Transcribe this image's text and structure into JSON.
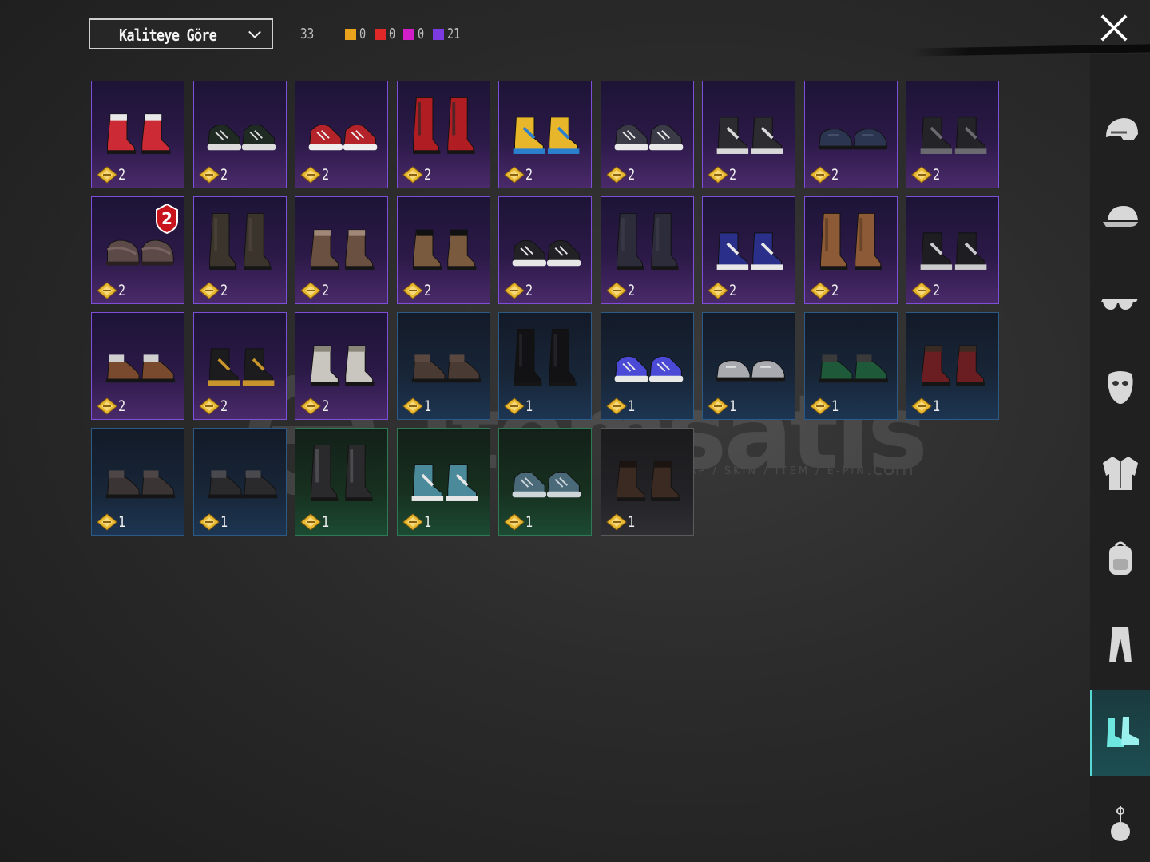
{
  "toolbar": {
    "sort_label": "Kaliteye Göre",
    "total_count": "33",
    "rarity_counts": [
      {
        "color": "#e8a21c",
        "value": "0"
      },
      {
        "color": "#e02828",
        "value": "0"
      },
      {
        "color": "#d21ec8",
        "value": "0"
      },
      {
        "color": "#7c3be0",
        "value": "21"
      }
    ]
  },
  "items": [
    {
      "rarity": "purple",
      "qty": "2",
      "colors": [
        "#cc2a35",
        "#e8e8e8"
      ],
      "style": "boot-short"
    },
    {
      "rarity": "purple",
      "qty": "2",
      "colors": [
        "#1f2a22",
        "#dcdcdc"
      ],
      "style": "sneaker"
    },
    {
      "rarity": "purple",
      "qty": "2",
      "colors": [
        "#b4232a",
        "#eeeeee"
      ],
      "style": "sneaker"
    },
    {
      "rarity": "purple",
      "qty": "2",
      "colors": [
        "#b01d22",
        "#2a2a2a"
      ],
      "style": "boot-tall"
    },
    {
      "rarity": "purple",
      "qty": "2",
      "colors": [
        "#e7b62a",
        "#2a7fcf"
      ],
      "style": "high-top"
    },
    {
      "rarity": "purple",
      "qty": "2",
      "colors": [
        "#3b3b48",
        "#e8e8e8"
      ],
      "style": "sneaker"
    },
    {
      "rarity": "purple",
      "qty": "2",
      "colors": [
        "#2b2b30",
        "#d8d8d8"
      ],
      "style": "high-top"
    },
    {
      "rarity": "purple",
      "qty": "2",
      "colors": [
        "#2c3550",
        "#44506a"
      ],
      "style": "loafer"
    },
    {
      "rarity": "purple",
      "qty": "2",
      "colors": [
        "#242428",
        "#6a6a70"
      ],
      "style": "high-top"
    },
    {
      "rarity": "purple",
      "qty": "2",
      "colors": [
        "#5c4a48",
        "#7a6462"
      ],
      "style": "slipper",
      "badge": "2"
    },
    {
      "rarity": "purple",
      "qty": "2",
      "colors": [
        "#3a342c",
        "#4e463a"
      ],
      "style": "boot-tall"
    },
    {
      "rarity": "purple",
      "qty": "2",
      "colors": [
        "#6a5040",
        "#a08878"
      ],
      "style": "boot-short"
    },
    {
      "rarity": "purple",
      "qty": "2",
      "colors": [
        "#7a5a3e",
        "#111111"
      ],
      "style": "boot-short"
    },
    {
      "rarity": "purple",
      "qty": "2",
      "colors": [
        "#222226",
        "#e6e6e6"
      ],
      "style": "sneaker"
    },
    {
      "rarity": "purple",
      "qty": "2",
      "colors": [
        "#2c2c3a",
        "#3c3c4c"
      ],
      "style": "boot-tall"
    },
    {
      "rarity": "purple",
      "qty": "2",
      "colors": [
        "#2a2f8a",
        "#e8e8e8"
      ],
      "style": "high-top"
    },
    {
      "rarity": "purple",
      "qty": "2",
      "colors": [
        "#8c5a36",
        "#5a3a22"
      ],
      "style": "boot-tall"
    },
    {
      "rarity": "purple",
      "qty": "2",
      "colors": [
        "#1e1e22",
        "#cccccc"
      ],
      "style": "high-top"
    },
    {
      "rarity": "purple",
      "qty": "2",
      "colors": [
        "#7a4a2e",
        "#cfcfcf"
      ],
      "style": "oxford"
    },
    {
      "rarity": "purple",
      "qty": "2",
      "colors": [
        "#1c1c1e",
        "#c8952c"
      ],
      "style": "high-top"
    },
    {
      "rarity": "purple",
      "qty": "2",
      "colors": [
        "#c8c6be",
        "#8a867a"
      ],
      "style": "boot-short"
    },
    {
      "rarity": "blue",
      "qty": "1",
      "colors": [
        "#4a3a34",
        "#5a4840"
      ],
      "style": "oxford"
    },
    {
      "rarity": "blue",
      "qty": "1",
      "colors": [
        "#121214",
        "#2a2a2e"
      ],
      "style": "boot-tall"
    },
    {
      "rarity": "blue",
      "qty": "1",
      "colors": [
        "#4a4ad6",
        "#e8e8e8"
      ],
      "style": "sneaker"
    },
    {
      "rarity": "blue",
      "qty": "1",
      "colors": [
        "#a8aab0",
        "#dedede"
      ],
      "style": "loafer"
    },
    {
      "rarity": "blue",
      "qty": "1",
      "colors": [
        "#1e5a3a",
        "#3a3a3a"
      ],
      "style": "oxford"
    },
    {
      "rarity": "blue",
      "qty": "1",
      "colors": [
        "#6a1e22",
        "#3a2a24"
      ],
      "style": "boot-short"
    },
    {
      "rarity": "blue",
      "qty": "1",
      "colors": [
        "#3a3434",
        "#4e4646"
      ],
      "style": "oxford"
    },
    {
      "rarity": "blue",
      "qty": "1",
      "colors": [
        "#2a2a2c",
        "#4a4a4e"
      ],
      "style": "oxford"
    },
    {
      "rarity": "green",
      "qty": "1",
      "colors": [
        "#2a2a2c",
        "#5a5a60"
      ],
      "style": "boot-tall"
    },
    {
      "rarity": "green",
      "qty": "1",
      "colors": [
        "#4a8a9a",
        "#e6e6e6"
      ],
      "style": "high-top"
    },
    {
      "rarity": "green",
      "qty": "1",
      "colors": [
        "#4a6a7a",
        "#cfd6da"
      ],
      "style": "sneaker"
    },
    {
      "rarity": "gray",
      "qty": "1",
      "colors": [
        "#3a2a22",
        "#1c1410"
      ],
      "style": "boot-short"
    }
  ],
  "sidebar": {
    "categories": [
      {
        "name": "helmet-icon"
      },
      {
        "name": "cap-icon"
      },
      {
        "name": "glasses-icon"
      },
      {
        "name": "mask-icon"
      },
      {
        "name": "jacket-icon"
      },
      {
        "name": "backpack-icon"
      },
      {
        "name": "pants-icon"
      },
      {
        "name": "shoes-icon",
        "active": true
      },
      {
        "name": "pendant-icon"
      }
    ]
  },
  "watermark": {
    "brand": "itemsatis",
    "tagline": "HESAP / SKIN / ITEM / E-PIN",
    "suffix": ".com"
  }
}
